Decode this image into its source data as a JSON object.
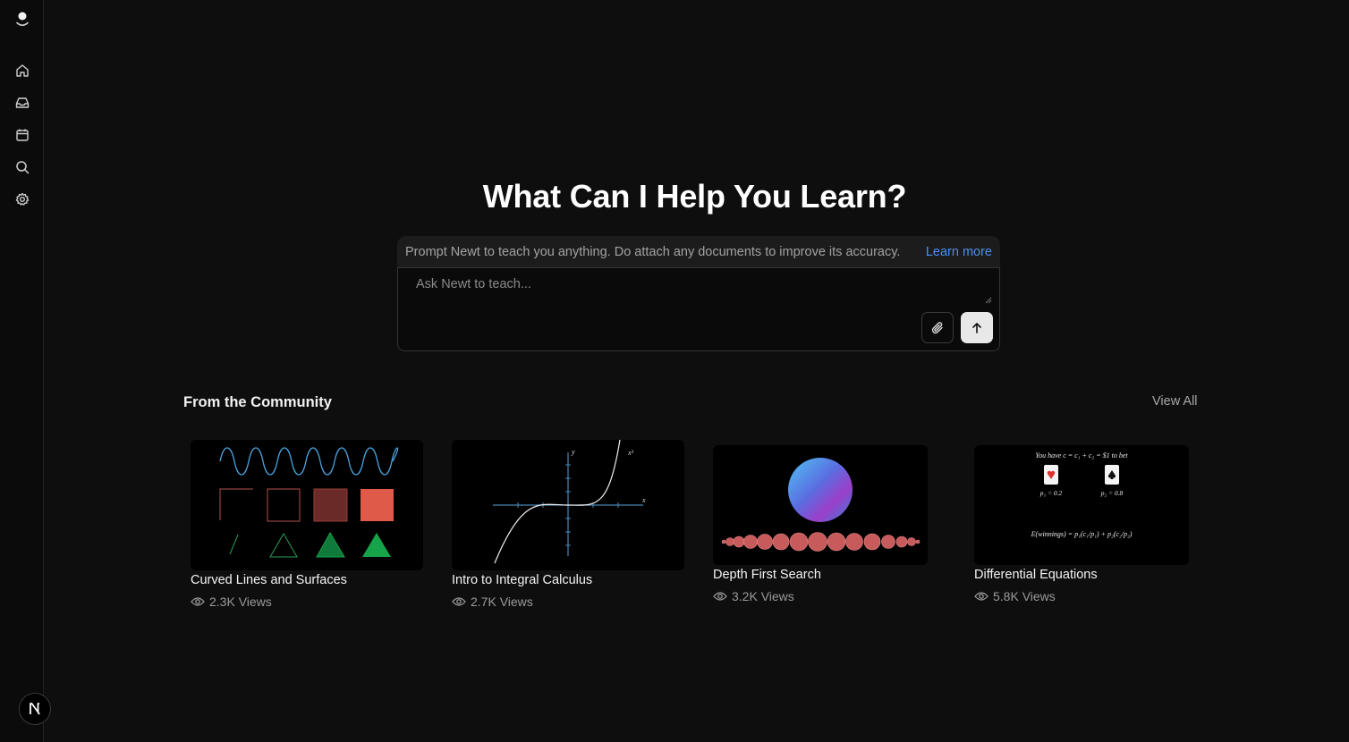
{
  "sidebar": {
    "logo_icon": "newt-logo-icon",
    "items": [
      {
        "name": "home",
        "icon": "home-icon"
      },
      {
        "name": "inbox",
        "icon": "inbox-icon"
      },
      {
        "name": "calendar",
        "icon": "calendar-icon"
      },
      {
        "name": "search",
        "icon": "search-icon"
      },
      {
        "name": "settings",
        "icon": "gear-icon"
      }
    ],
    "avatar_letter": "N"
  },
  "hero": {
    "title": "What Can I Help You Learn?"
  },
  "prompt": {
    "info_text": "Prompt Newt to teach you anything. Do attach any documents to improve its accuracy.",
    "learn_more": "Learn more",
    "placeholder": "Ask Newt to teach...",
    "attach_icon": "paperclip-icon",
    "send_icon": "arrow-up-icon"
  },
  "community": {
    "title": "From the Community",
    "view_all": "View All",
    "cards": [
      {
        "title": "Curved Lines and Surfaces",
        "views": "2.3K Views"
      },
      {
        "title": "Intro to Integral Calculus",
        "views": "2.7K Views"
      },
      {
        "title": "Depth First Search",
        "views": "3.2K Views"
      },
      {
        "title": "Differential Equations",
        "views": "5.8K Views"
      }
    ],
    "thumb_text": {
      "calc_y": "y",
      "calc_x": "x",
      "calc_fn": "x³",
      "prob_line1": "You have c = c₁ + c₂ = $1 to bet",
      "prob_p1": "p₁ = 0.2",
      "prob_p2": "p₂ = 0.8",
      "prob_eq": "E(winnings) = p₁(c₁/p₁) + p₂(c₂/p₂)"
    }
  },
  "colors": {
    "background": "#0e0e0e",
    "accent_link": "#4d8ef7",
    "sine_wave": "#4aa3df",
    "square_red": "#e05a4a",
    "triangle_green": "#17a34a",
    "dfs_node": "#e06a6a"
  }
}
